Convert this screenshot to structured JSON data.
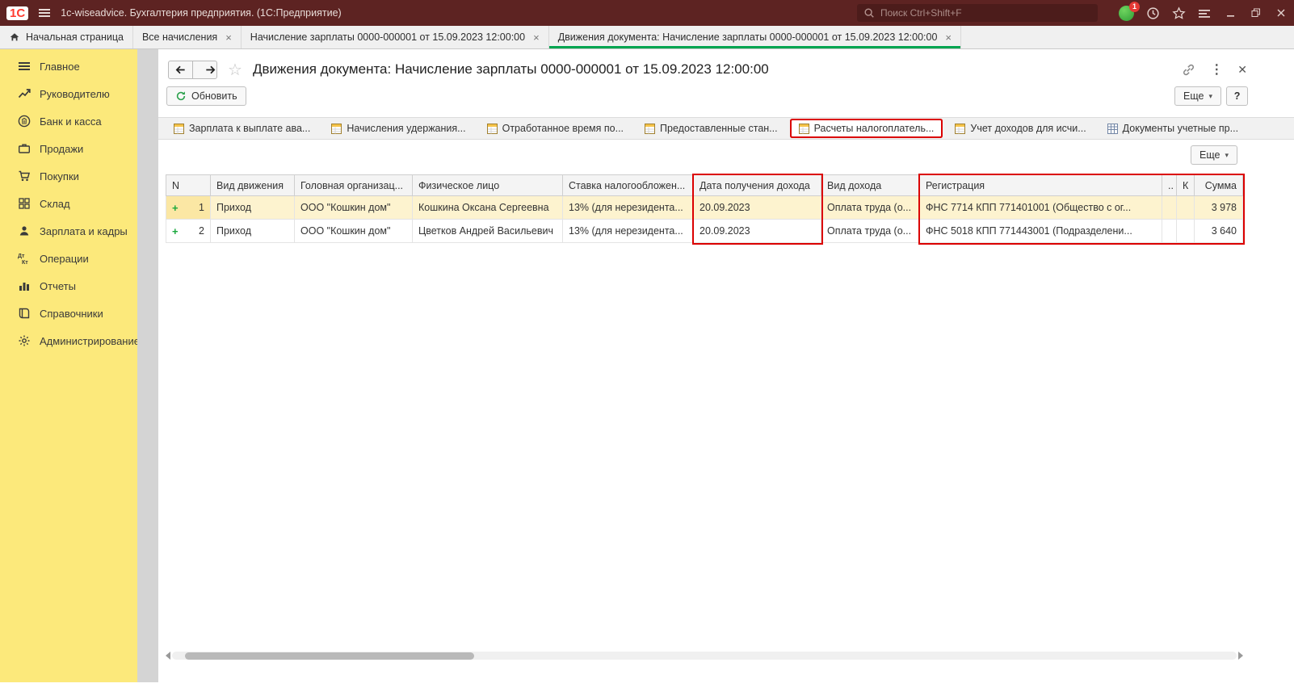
{
  "window": {
    "logo": "1С",
    "title": "1c-wiseadvice. Бухгалтерия предприятия. (1С:Предприятие)",
    "search_placeholder": "Поиск Ctrl+Shift+F",
    "notification_badge": "1"
  },
  "tabs": [
    {
      "label": "Начальная страница",
      "home": true,
      "closable": false,
      "active": false
    },
    {
      "label": "Все начисления",
      "home": false,
      "closable": true,
      "active": false
    },
    {
      "label": "Начисление зарплаты 0000-000001 от 15.09.2023 12:00:00",
      "home": false,
      "closable": true,
      "active": false
    },
    {
      "label": "Движения документа: Начисление зарплаты 0000-000001 от 15.09.2023 12:00:00",
      "home": false,
      "closable": true,
      "active": true
    }
  ],
  "sidebar": [
    {
      "label": "Главное",
      "icon": "sections-icon"
    },
    {
      "label": "Руководителю",
      "icon": "trend-icon"
    },
    {
      "label": "Банк и касса",
      "icon": "bank-icon"
    },
    {
      "label": "Продажи",
      "icon": "sales-icon"
    },
    {
      "label": "Покупки",
      "icon": "cart-icon"
    },
    {
      "label": "Склад",
      "icon": "warehouse-icon"
    },
    {
      "label": "Зарплата и кадры",
      "icon": "people-icon"
    },
    {
      "label": "Операции",
      "icon": "dtkt-icon"
    },
    {
      "label": "Отчеты",
      "icon": "report-icon"
    },
    {
      "label": "Справочники",
      "icon": "book-icon"
    },
    {
      "label": "Администрирование",
      "icon": "gear-icon"
    }
  ],
  "main": {
    "title": "Движения документа: Начисление зарплаты 0000-000001 от 15.09.2023 12:00:00",
    "refresh_button": "Обновить",
    "more_button": "Еще",
    "help_button": "?",
    "table_more_button": "Еще",
    "register_tabs": [
      {
        "label": "Зарплата к выплате ава...",
        "icon": "reg-icon"
      },
      {
        "label": "Начисления удержания...",
        "icon": "reg-icon"
      },
      {
        "label": "Отработанное время по...",
        "icon": "reg-icon"
      },
      {
        "label": "Предоставленные стан...",
        "icon": "reg-icon"
      },
      {
        "label": "Расчеты налогоплатель...",
        "icon": "reg-icon"
      },
      {
        "label": "Учет доходов для исчи...",
        "icon": "reg-icon"
      },
      {
        "label": "Документы учетные пр...",
        "icon": "doc-reg-icon"
      }
    ],
    "table": {
      "row_expander": "+",
      "columns": [
        "N",
        "Вид движения",
        "Головная организац...",
        "Физическое лицо",
        "Ставка налогообложен...",
        "Дата получения дохода",
        "Вид дохода",
        "Регистрация",
        "..",
        "К",
        "Сумма"
      ],
      "rows": [
        [
          "1",
          "Приход",
          "ООО \"Кошкин дом\"",
          "Кошкина Оксана Сергеевна",
          "13% (для нерезидента...",
          "20.09.2023",
          "Оплата труда (о...",
          "ФНС 7714 КПП 771401001 (Общество с ог...",
          "",
          "",
          "3 978"
        ],
        [
          "2",
          "Приход",
          "ООО \"Кошкин дом\"",
          "Цветков Андрей Васильевич",
          "13% (для нерезидента...",
          "20.09.2023",
          "Оплата труда (о...",
          "ФНС 5018 КПП 771443001 (Подразделени...",
          "",
          "",
          "3 640"
        ]
      ]
    }
  },
  "annotations": {
    "register_tab_highlighted": "Расчеты налогоплатель...",
    "column_highlights": [
      {
        "from": 5,
        "to": 5
      },
      {
        "from": 7,
        "to": 10
      }
    ]
  }
}
